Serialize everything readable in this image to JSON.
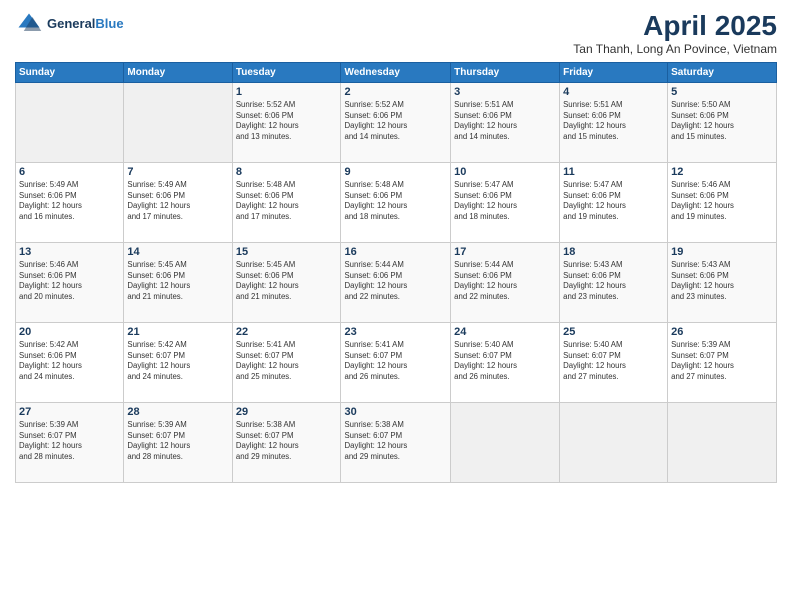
{
  "header": {
    "logo_general": "General",
    "logo_blue": "Blue",
    "month_title": "April 2025",
    "subtitle": "Tan Thanh, Long An Povince, Vietnam"
  },
  "days_of_week": [
    "Sunday",
    "Monday",
    "Tuesday",
    "Wednesday",
    "Thursday",
    "Friday",
    "Saturday"
  ],
  "weeks": [
    [
      {
        "day": "",
        "info": ""
      },
      {
        "day": "",
        "info": ""
      },
      {
        "day": "1",
        "info": "Sunrise: 5:52 AM\nSunset: 6:06 PM\nDaylight: 12 hours\nand 13 minutes."
      },
      {
        "day": "2",
        "info": "Sunrise: 5:52 AM\nSunset: 6:06 PM\nDaylight: 12 hours\nand 14 minutes."
      },
      {
        "day": "3",
        "info": "Sunrise: 5:51 AM\nSunset: 6:06 PM\nDaylight: 12 hours\nand 14 minutes."
      },
      {
        "day": "4",
        "info": "Sunrise: 5:51 AM\nSunset: 6:06 PM\nDaylight: 12 hours\nand 15 minutes."
      },
      {
        "day": "5",
        "info": "Sunrise: 5:50 AM\nSunset: 6:06 PM\nDaylight: 12 hours\nand 15 minutes."
      }
    ],
    [
      {
        "day": "6",
        "info": "Sunrise: 5:49 AM\nSunset: 6:06 PM\nDaylight: 12 hours\nand 16 minutes."
      },
      {
        "day": "7",
        "info": "Sunrise: 5:49 AM\nSunset: 6:06 PM\nDaylight: 12 hours\nand 17 minutes."
      },
      {
        "day": "8",
        "info": "Sunrise: 5:48 AM\nSunset: 6:06 PM\nDaylight: 12 hours\nand 17 minutes."
      },
      {
        "day": "9",
        "info": "Sunrise: 5:48 AM\nSunset: 6:06 PM\nDaylight: 12 hours\nand 18 minutes."
      },
      {
        "day": "10",
        "info": "Sunrise: 5:47 AM\nSunset: 6:06 PM\nDaylight: 12 hours\nand 18 minutes."
      },
      {
        "day": "11",
        "info": "Sunrise: 5:47 AM\nSunset: 6:06 PM\nDaylight: 12 hours\nand 19 minutes."
      },
      {
        "day": "12",
        "info": "Sunrise: 5:46 AM\nSunset: 6:06 PM\nDaylight: 12 hours\nand 19 minutes."
      }
    ],
    [
      {
        "day": "13",
        "info": "Sunrise: 5:46 AM\nSunset: 6:06 PM\nDaylight: 12 hours\nand 20 minutes."
      },
      {
        "day": "14",
        "info": "Sunrise: 5:45 AM\nSunset: 6:06 PM\nDaylight: 12 hours\nand 21 minutes."
      },
      {
        "day": "15",
        "info": "Sunrise: 5:45 AM\nSunset: 6:06 PM\nDaylight: 12 hours\nand 21 minutes."
      },
      {
        "day": "16",
        "info": "Sunrise: 5:44 AM\nSunset: 6:06 PM\nDaylight: 12 hours\nand 22 minutes."
      },
      {
        "day": "17",
        "info": "Sunrise: 5:44 AM\nSunset: 6:06 PM\nDaylight: 12 hours\nand 22 minutes."
      },
      {
        "day": "18",
        "info": "Sunrise: 5:43 AM\nSunset: 6:06 PM\nDaylight: 12 hours\nand 23 minutes."
      },
      {
        "day": "19",
        "info": "Sunrise: 5:43 AM\nSunset: 6:06 PM\nDaylight: 12 hours\nand 23 minutes."
      }
    ],
    [
      {
        "day": "20",
        "info": "Sunrise: 5:42 AM\nSunset: 6:06 PM\nDaylight: 12 hours\nand 24 minutes."
      },
      {
        "day": "21",
        "info": "Sunrise: 5:42 AM\nSunset: 6:07 PM\nDaylight: 12 hours\nand 24 minutes."
      },
      {
        "day": "22",
        "info": "Sunrise: 5:41 AM\nSunset: 6:07 PM\nDaylight: 12 hours\nand 25 minutes."
      },
      {
        "day": "23",
        "info": "Sunrise: 5:41 AM\nSunset: 6:07 PM\nDaylight: 12 hours\nand 26 minutes."
      },
      {
        "day": "24",
        "info": "Sunrise: 5:40 AM\nSunset: 6:07 PM\nDaylight: 12 hours\nand 26 minutes."
      },
      {
        "day": "25",
        "info": "Sunrise: 5:40 AM\nSunset: 6:07 PM\nDaylight: 12 hours\nand 27 minutes."
      },
      {
        "day": "26",
        "info": "Sunrise: 5:39 AM\nSunset: 6:07 PM\nDaylight: 12 hours\nand 27 minutes."
      }
    ],
    [
      {
        "day": "27",
        "info": "Sunrise: 5:39 AM\nSunset: 6:07 PM\nDaylight: 12 hours\nand 28 minutes."
      },
      {
        "day": "28",
        "info": "Sunrise: 5:39 AM\nSunset: 6:07 PM\nDaylight: 12 hours\nand 28 minutes."
      },
      {
        "day": "29",
        "info": "Sunrise: 5:38 AM\nSunset: 6:07 PM\nDaylight: 12 hours\nand 29 minutes."
      },
      {
        "day": "30",
        "info": "Sunrise: 5:38 AM\nSunset: 6:07 PM\nDaylight: 12 hours\nand 29 minutes."
      },
      {
        "day": "",
        "info": ""
      },
      {
        "day": "",
        "info": ""
      },
      {
        "day": "",
        "info": ""
      }
    ]
  ]
}
